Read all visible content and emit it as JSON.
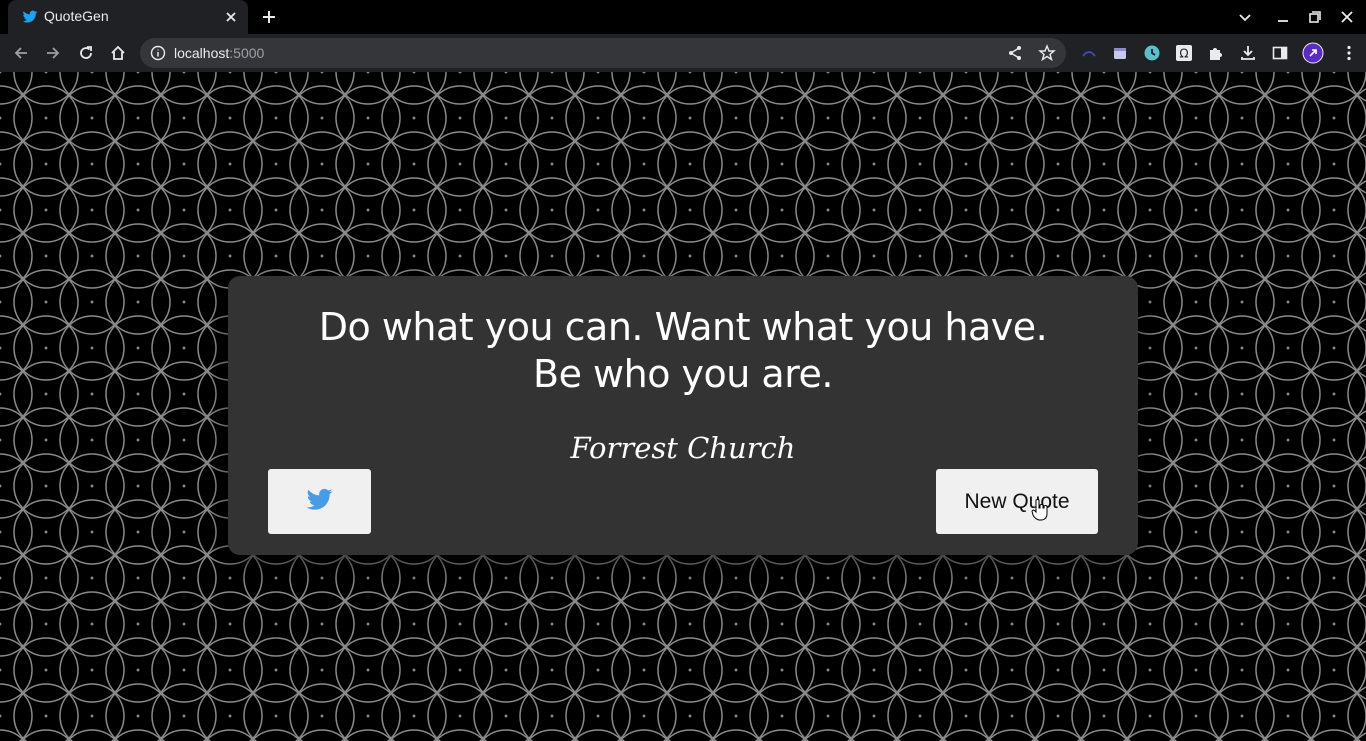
{
  "browser": {
    "tab_title": "QuoteGen",
    "url_host": "localhost",
    "url_port": ":5000",
    "icons": {
      "back": "arrow-left-icon",
      "forward": "arrow-right-icon",
      "reload": "reload-icon",
      "home": "home-icon",
      "info": "info-icon",
      "share": "share-icon",
      "bookmark": "star-icon",
      "extensions": "puzzle-icon",
      "downloads": "download-icon",
      "side_panel": "side-panel-icon",
      "menu": "kebab-menu-icon"
    }
  },
  "quote": {
    "text": "Do what you can. Want what you have. Be who you are.",
    "author": "Forrest Church"
  },
  "buttons": {
    "new_quote": "New Quote",
    "tweet_icon": "twitter-icon"
  },
  "colors": {
    "card": "#333333",
    "button": "#f0f0f0",
    "twitter_blue": "#1da1f2",
    "pattern_line": "#8a8a8a"
  }
}
